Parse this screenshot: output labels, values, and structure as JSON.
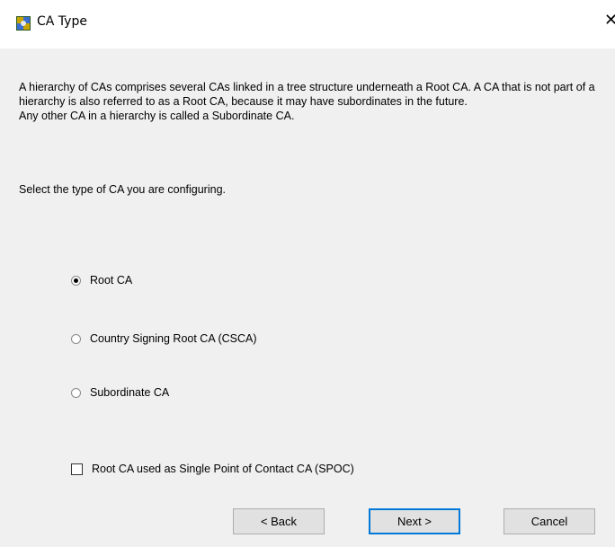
{
  "window": {
    "title": "CA Type",
    "close_glyph": "✕"
  },
  "description": {
    "lines": [
      "A hierarchy of CAs comprises several CAs linked in a tree structure underneath a Root CA. A CA that is not part of a hierarchy is also referred to as a Root CA, because it may have  subordinates in the future.",
      "Any other CA in a hierarchy is called a Subordinate CA."
    ],
    "prompt": "Select the type of CA you are configuring."
  },
  "options": [
    {
      "label": "Root CA",
      "checked": true
    },
    {
      "label": "Country Signing Root CA (CSCA)",
      "checked": false
    },
    {
      "label": "Subordinate CA",
      "checked": false
    }
  ],
  "spoc_checkbox": {
    "label": "Root CA used as Single Point of Contact CA (SPOC)",
    "checked": false
  },
  "buttons": {
    "back": "< Back",
    "next": "Next >",
    "cancel": "Cancel"
  },
  "icons": {
    "app": "certificate-app-icon"
  }
}
